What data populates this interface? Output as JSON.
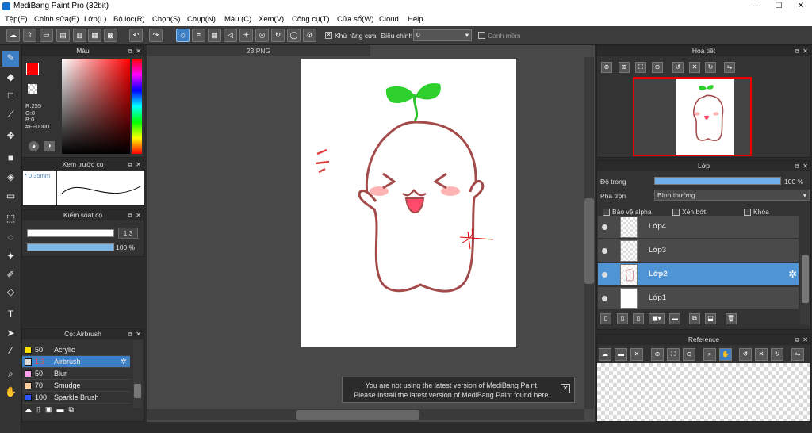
{
  "window": {
    "title": "MediBang Paint Pro (32bit)",
    "minimize": "—",
    "maximize": "☐",
    "close": "✕"
  },
  "menu": [
    "Tệp(F)",
    "Chỉnh sửa(E)",
    "Lớp(L)",
    "Bộ lọc(R)",
    "Chọn(S)",
    "Chụp(N)",
    "Màu (C)",
    "Xem(V)",
    "Công cụ(T)",
    "Cửa sổ(W)",
    "Cloud",
    "Help"
  ],
  "toolbar": {
    "antialias_label": "Khử răng cưa",
    "antialias_check": "✕",
    "adjust_label": "Điều chỉnh",
    "adjust_value": "0",
    "snap_label": "Canh mềm"
  },
  "document": {
    "tab": "23.PNG"
  },
  "color_panel": {
    "title": "Màu",
    "r": "R:255",
    "g": "G:0",
    "b": "B:0",
    "hex": "#FF0000",
    "current_color": "#ff0000"
  },
  "brush_preview": {
    "title": "Xem trước cọ",
    "size": "0.35mm"
  },
  "brush_control": {
    "title": "Kiểm soát cọ",
    "size_value": "1.3",
    "opacity_value": "100 %"
  },
  "brush_list": {
    "title": "Cọ: Airbrush",
    "items": [
      {
        "size": "50",
        "name": "Acrylic",
        "color": "#ffe000"
      },
      {
        "size": "1.3",
        "name": "Airbrush",
        "color": "#dddddd"
      },
      {
        "size": "50",
        "name": "Blur",
        "color": "#ff9eea"
      },
      {
        "size": "70",
        "name": "Smudge",
        "color": "#ffcfa0"
      },
      {
        "size": "100",
        "name": "Sparkle Brush",
        "color": "#2b55ff"
      }
    ]
  },
  "navigator": {
    "title": "Họa tiết"
  },
  "layers": {
    "title": "Lớp",
    "opacity_label": "Độ trong",
    "opacity_value": "100 %",
    "opacity_fraction": 1.0,
    "blend_label": "Pha trộn",
    "blend_value": "Bình thường",
    "protect_alpha": "Bảo vệ alpha",
    "clipping": "Xén bớt",
    "lock": "Khóa",
    "items": [
      {
        "name": "Lớp4"
      },
      {
        "name": "Lớp3"
      },
      {
        "name": "Lớp2"
      },
      {
        "name": "Lớp1"
      }
    ]
  },
  "reference": {
    "title": "Reference"
  },
  "notice": {
    "line1": "You are not using the latest version of MediBang Paint.",
    "line2": "Please install the latest version of MediBang Paint found here.",
    "close": "✕"
  }
}
